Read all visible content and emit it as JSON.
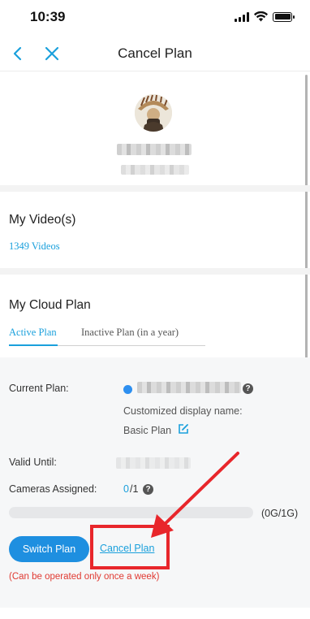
{
  "status_bar": {
    "time": "10:39"
  },
  "nav": {
    "title": "Cancel Plan"
  },
  "videos": {
    "section_title": "My Video(s)",
    "count_label": "1349 Videos"
  },
  "cloud_plan": {
    "section_title": "My Cloud Plan",
    "tabs": [
      {
        "label": "Active Plan",
        "active": true
      },
      {
        "label": "Inactive Plan (in a year)",
        "active": false
      }
    ]
  },
  "plan": {
    "current_plan_label": "Current Plan:",
    "display_name_label": "Customized display name:",
    "display_name_value": "Basic Plan",
    "valid_until_label": "Valid Until:",
    "cameras_label": "Cameras Assigned:",
    "cameras_used": "0",
    "cameras_total": "/1",
    "storage_text": "(0G/1G)",
    "storage_fraction": 0
  },
  "actions": {
    "switch_plan": "Switch Plan",
    "cancel_plan": "Cancel Plan",
    "notice": "(Can be operated only once a week)"
  },
  "colors": {
    "accent": "#1aa0dc",
    "button": "#1e8fe0",
    "annotation": "#e8262b",
    "warning": "#e03a32"
  },
  "icons": [
    "chevron-left-icon",
    "close-icon",
    "help-icon",
    "edit-icon",
    "wifi-icon",
    "battery-icon",
    "signal-icon"
  ]
}
